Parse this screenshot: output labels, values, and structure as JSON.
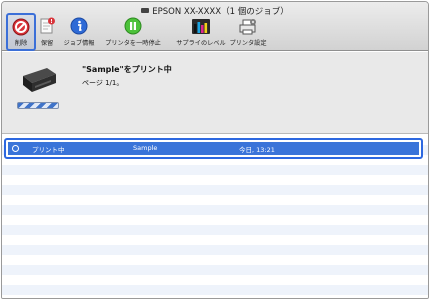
{
  "window": {
    "title": "EPSON XX-XXXX（1 個のジョブ）"
  },
  "toolbar": {
    "delete_label": "削除",
    "hold_label": "保留",
    "job_info_label": "ジョブ情報",
    "pause_label": "プリンタを一時停止",
    "supply_label": "サプライのレベル",
    "settings_label": "プリンタ設定"
  },
  "job": {
    "title": "\"Sample\"をプリント中",
    "page": "ページ 1/1。"
  },
  "list": {
    "rows": [
      {
        "status": "プリント中",
        "document": "Sample",
        "time": "今日, 13:21"
      }
    ]
  },
  "colors": {
    "selection": "#3a74d9",
    "highlight_border": "#2d68e0",
    "delete_red": "#d9333a"
  }
}
